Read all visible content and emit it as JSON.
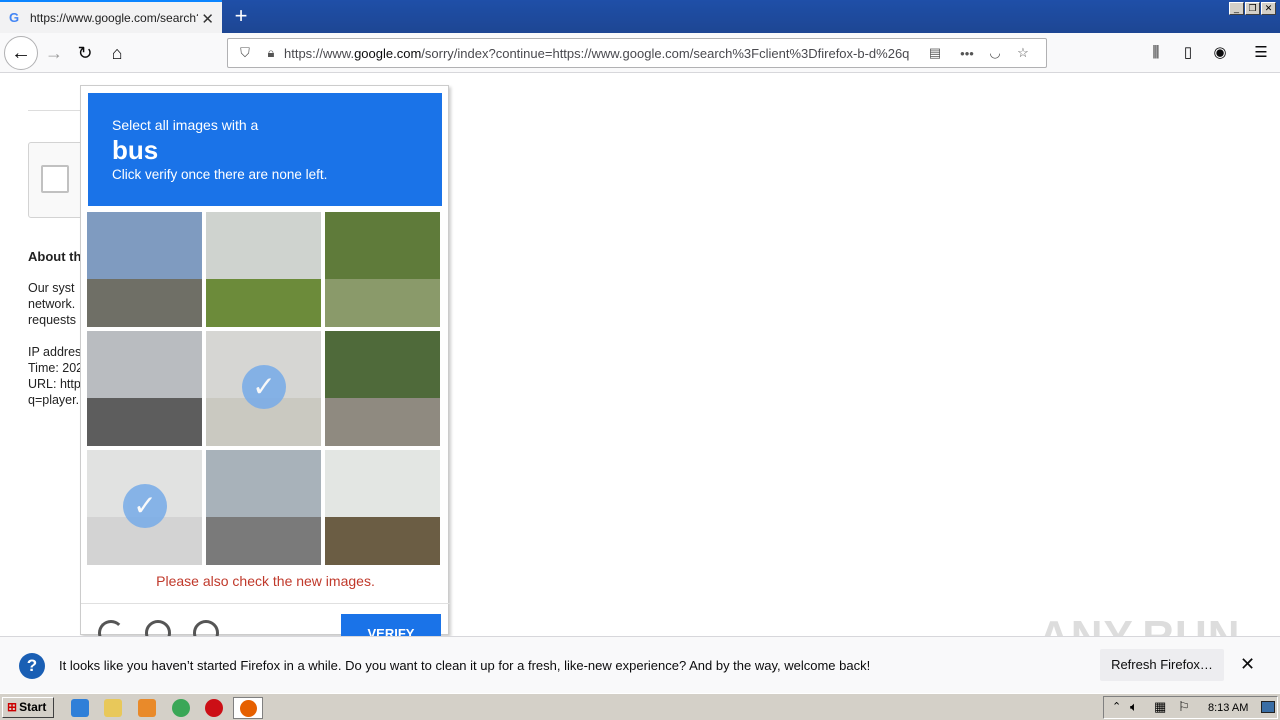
{
  "browser": {
    "tab_title": "https://www.google.com/search?c",
    "tab_favicon": "G",
    "url_prefix": "https://www.",
    "url_domain": "google.com",
    "url_rest": "/sorry/index?continue=https://www.google.com/search%3Fclient%3Dfirefox-b-d%26q"
  },
  "page": {
    "about_heading": "About th",
    "lines": [
      "Our syst",
      "network.",
      "requests",
      "",
      "IP addres",
      "Time: 202",
      "URL: http",
      "q=player."
    ]
  },
  "captcha": {
    "instruction_line1": "Select all images with a",
    "target": "bus",
    "instruction_line3": "Click verify once there are none left.",
    "message": "Please also check the new images.",
    "verify_label": "VERIFY",
    "tiles": [
      {
        "sky": "#7f9bc0",
        "ground": "#6f6f66",
        "sel": false
      },
      {
        "sky": "#cfd3cf",
        "ground": "#6c8b3a",
        "sel": false
      },
      {
        "sky": "#5f7b3a",
        "ground": "#8a9a6a",
        "sel": false
      },
      {
        "sky": "#b9bcc0",
        "ground": "#5d5d5d",
        "sel": false
      },
      {
        "sky": "#c9c9c5",
        "ground": "#b9b7ad",
        "sel": true
      },
      {
        "sky": "#4f6a3a",
        "ground": "#8f8a80",
        "sel": false
      },
      {
        "sky": "#d7d9d7",
        "ground": "#c5c5c5",
        "sel": true
      },
      {
        "sky": "#a8b2ba",
        "ground": "#7a7a7a",
        "sel": false
      },
      {
        "sky": "#e3e6e3",
        "ground": "#6b5d44",
        "sel": false
      }
    ]
  },
  "notification": {
    "text": "It looks like you haven’t started Firefox in a while. Do you want to clean it up for a fresh, like-new experience? And by the way, welcome back!",
    "button": "Refresh Firefox…"
  },
  "watermark": "ANY.RUN",
  "taskbar": {
    "start_label": "Start",
    "clock": "8:13 AM"
  }
}
